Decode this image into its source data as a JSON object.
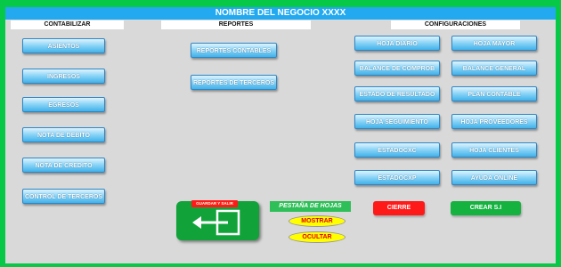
{
  "header": {
    "title": "NOMBRE DEL NEGOCIO XXXX"
  },
  "sections": {
    "contabilizar": "CONTABILIZAR",
    "reportes": "REPORTES",
    "configuraciones": "CONFIGURACIONES"
  },
  "contabilizar_buttons": [
    "ASIENTOS",
    "INGRESOS",
    "EGRESOS",
    "NOTA DE DEBITO",
    "NOTA DE CREDITO",
    "CONTROL DE TERCEROS"
  ],
  "reportes_buttons": [
    "REPORTES CONTABLES",
    "REPORTES DE TERCEROS"
  ],
  "config_left": [
    "HOJA DIARIO",
    "BALANCE DE COMPROB",
    "ESTADO DE RESULTADO",
    "HOJA SEGUIMIENTO",
    "ESTADOCXC",
    "ESTADOCXP"
  ],
  "config_right": [
    "HOJA MAYOR",
    "BALANCE GENERAL",
    "PLAN CONTABLE",
    "HOJA PROVEEDORES",
    "HOJA CLIENTES",
    "AYUDA ONLINE"
  ],
  "exit_button": {
    "label": "GUARDAR Y SALIR",
    "icon": "exit-arrow-icon"
  },
  "pestana": {
    "label": "PESTAÑA DE HOJAS",
    "mostrar": "MOSTRAR",
    "ocultar": "OCULTAR"
  },
  "cierre": "CIERRE",
  "crear": "CREAR S.I",
  "colors": {
    "frame": "#08c848",
    "title_bar": "#22a9f0",
    "button_blue": "#41b2ea",
    "red": "#ff1a1a",
    "green": "#15b23f",
    "yellow": "#ffff00"
  }
}
